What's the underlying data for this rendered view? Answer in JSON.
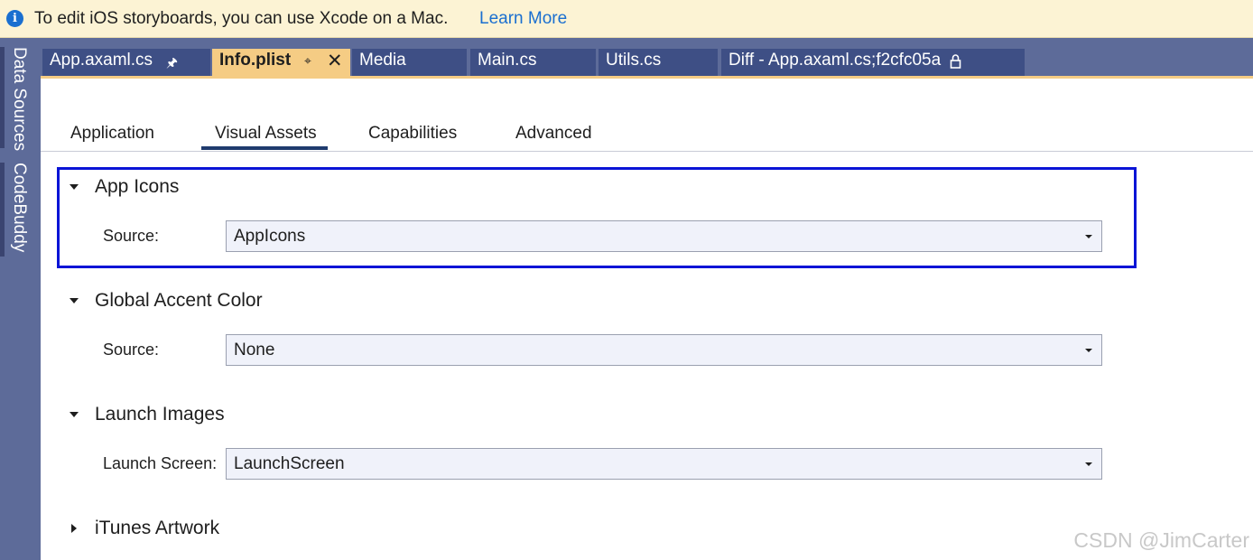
{
  "infobar": {
    "message": "To edit iOS storyboards, you can use Xcode on a Mac.",
    "link": "Learn More",
    "icon": "info-icon"
  },
  "left_strip": {
    "items": [
      {
        "label": "Data Sources"
      },
      {
        "label": "CodeBuddy"
      }
    ]
  },
  "doc_tabs": [
    {
      "label": "App.axaml.cs",
      "pinned": true,
      "active": false
    },
    {
      "label": "Info.plist",
      "pinned": true,
      "active": true
    },
    {
      "label": "Media",
      "active": false
    },
    {
      "label": "Main.cs",
      "active": false
    },
    {
      "label": "Utils.cs",
      "active": false
    },
    {
      "label": "Diff - App.axaml.cs;f2cfc05a",
      "locked": true,
      "active": false
    }
  ],
  "sub_tabs": [
    {
      "label": "Application"
    },
    {
      "label": "Visual Assets",
      "selected": true
    },
    {
      "label": "Capabilities"
    },
    {
      "label": "Advanced"
    }
  ],
  "sections": [
    {
      "title": "App Icons",
      "expanded": true,
      "field_label": "Source:",
      "value": "AppIcons"
    },
    {
      "title": "Global Accent Color",
      "expanded": true,
      "field_label": "Source:",
      "value": "None"
    },
    {
      "title": "Launch Images",
      "expanded": true,
      "field_label": "Launch Screen:",
      "value": "LaunchScreen"
    },
    {
      "title": "iTunes Artwork",
      "expanded": false
    }
  ],
  "watermark": "CSDN @JimCarter",
  "colors": {
    "infobar_bg": "#fcf3d4",
    "link": "#1a6fd0",
    "tab_strip": "#5d6b99",
    "active_tab": "#f5cc84",
    "highlight": "#0a14d6"
  }
}
